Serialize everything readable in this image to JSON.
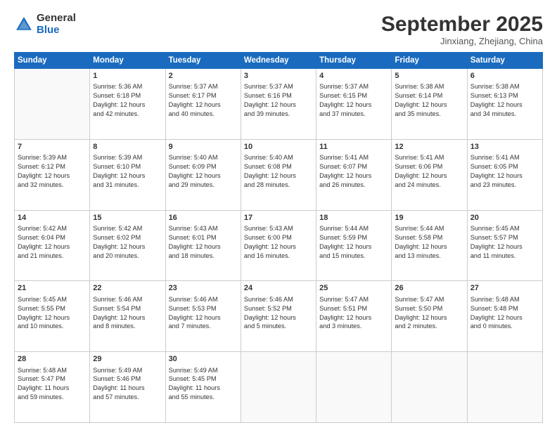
{
  "logo": {
    "line1": "General",
    "line2": "Blue"
  },
  "title": "September 2025",
  "subtitle": "Jinxiang, Zhejiang, China",
  "days": [
    "Sunday",
    "Monday",
    "Tuesday",
    "Wednesday",
    "Thursday",
    "Friday",
    "Saturday"
  ],
  "weeks": [
    [
      {
        "day": "",
        "info": ""
      },
      {
        "day": "1",
        "info": "Sunrise: 5:36 AM\nSunset: 6:18 PM\nDaylight: 12 hours\nand 42 minutes."
      },
      {
        "day": "2",
        "info": "Sunrise: 5:37 AM\nSunset: 6:17 PM\nDaylight: 12 hours\nand 40 minutes."
      },
      {
        "day": "3",
        "info": "Sunrise: 5:37 AM\nSunset: 6:16 PM\nDaylight: 12 hours\nand 39 minutes."
      },
      {
        "day": "4",
        "info": "Sunrise: 5:37 AM\nSunset: 6:15 PM\nDaylight: 12 hours\nand 37 minutes."
      },
      {
        "day": "5",
        "info": "Sunrise: 5:38 AM\nSunset: 6:14 PM\nDaylight: 12 hours\nand 35 minutes."
      },
      {
        "day": "6",
        "info": "Sunrise: 5:38 AM\nSunset: 6:13 PM\nDaylight: 12 hours\nand 34 minutes."
      }
    ],
    [
      {
        "day": "7",
        "info": "Sunrise: 5:39 AM\nSunset: 6:12 PM\nDaylight: 12 hours\nand 32 minutes."
      },
      {
        "day": "8",
        "info": "Sunrise: 5:39 AM\nSunset: 6:10 PM\nDaylight: 12 hours\nand 31 minutes."
      },
      {
        "day": "9",
        "info": "Sunrise: 5:40 AM\nSunset: 6:09 PM\nDaylight: 12 hours\nand 29 minutes."
      },
      {
        "day": "10",
        "info": "Sunrise: 5:40 AM\nSunset: 6:08 PM\nDaylight: 12 hours\nand 28 minutes."
      },
      {
        "day": "11",
        "info": "Sunrise: 5:41 AM\nSunset: 6:07 PM\nDaylight: 12 hours\nand 26 minutes."
      },
      {
        "day": "12",
        "info": "Sunrise: 5:41 AM\nSunset: 6:06 PM\nDaylight: 12 hours\nand 24 minutes."
      },
      {
        "day": "13",
        "info": "Sunrise: 5:41 AM\nSunset: 6:05 PM\nDaylight: 12 hours\nand 23 minutes."
      }
    ],
    [
      {
        "day": "14",
        "info": "Sunrise: 5:42 AM\nSunset: 6:04 PM\nDaylight: 12 hours\nand 21 minutes."
      },
      {
        "day": "15",
        "info": "Sunrise: 5:42 AM\nSunset: 6:02 PM\nDaylight: 12 hours\nand 20 minutes."
      },
      {
        "day": "16",
        "info": "Sunrise: 5:43 AM\nSunset: 6:01 PM\nDaylight: 12 hours\nand 18 minutes."
      },
      {
        "day": "17",
        "info": "Sunrise: 5:43 AM\nSunset: 6:00 PM\nDaylight: 12 hours\nand 16 minutes."
      },
      {
        "day": "18",
        "info": "Sunrise: 5:44 AM\nSunset: 5:59 PM\nDaylight: 12 hours\nand 15 minutes."
      },
      {
        "day": "19",
        "info": "Sunrise: 5:44 AM\nSunset: 5:58 PM\nDaylight: 12 hours\nand 13 minutes."
      },
      {
        "day": "20",
        "info": "Sunrise: 5:45 AM\nSunset: 5:57 PM\nDaylight: 12 hours\nand 11 minutes."
      }
    ],
    [
      {
        "day": "21",
        "info": "Sunrise: 5:45 AM\nSunset: 5:55 PM\nDaylight: 12 hours\nand 10 minutes."
      },
      {
        "day": "22",
        "info": "Sunrise: 5:46 AM\nSunset: 5:54 PM\nDaylight: 12 hours\nand 8 minutes."
      },
      {
        "day": "23",
        "info": "Sunrise: 5:46 AM\nSunset: 5:53 PM\nDaylight: 12 hours\nand 7 minutes."
      },
      {
        "day": "24",
        "info": "Sunrise: 5:46 AM\nSunset: 5:52 PM\nDaylight: 12 hours\nand 5 minutes."
      },
      {
        "day": "25",
        "info": "Sunrise: 5:47 AM\nSunset: 5:51 PM\nDaylight: 12 hours\nand 3 minutes."
      },
      {
        "day": "26",
        "info": "Sunrise: 5:47 AM\nSunset: 5:50 PM\nDaylight: 12 hours\nand 2 minutes."
      },
      {
        "day": "27",
        "info": "Sunrise: 5:48 AM\nSunset: 5:48 PM\nDaylight: 12 hours\nand 0 minutes."
      }
    ],
    [
      {
        "day": "28",
        "info": "Sunrise: 5:48 AM\nSunset: 5:47 PM\nDaylight: 11 hours\nand 59 minutes."
      },
      {
        "day": "29",
        "info": "Sunrise: 5:49 AM\nSunset: 5:46 PM\nDaylight: 11 hours\nand 57 minutes."
      },
      {
        "day": "30",
        "info": "Sunrise: 5:49 AM\nSunset: 5:45 PM\nDaylight: 11 hours\nand 55 minutes."
      },
      {
        "day": "",
        "info": ""
      },
      {
        "day": "",
        "info": ""
      },
      {
        "day": "",
        "info": ""
      },
      {
        "day": "",
        "info": ""
      }
    ]
  ]
}
